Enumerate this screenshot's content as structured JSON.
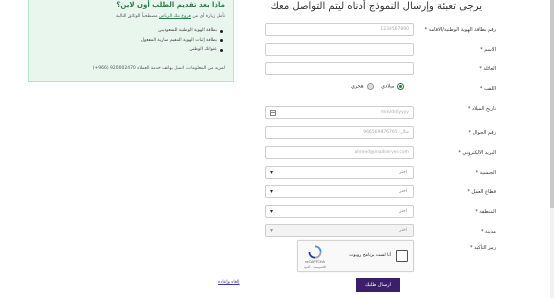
{
  "info_box": {
    "title": "ماذا بعد تقديم الطلب أون لاين؟",
    "intro_prefix": "نأمل زيارة أي من",
    "intro_link": "فروع بنك الرياض",
    "intro_suffix": "مصطحباً الوثائق التالية",
    "documents": [
      "بطاقة الهوية الوطنية للسعوديين",
      "بطاقة إثبات الهوية المقيم سارية المفعول",
      "عنوانك الوطني"
    ],
    "contact": "لمزيد من المعلومات، اتصل بهاتف خدمة العملاء 920002470 (966+)"
  },
  "form": {
    "heading": "يرجى تعبئة وإرسال النموذج أدناه ليتم التواصل معك",
    "labels": {
      "id_number": "رقم بطاقة الهوية الوطنية/الاقامة *",
      "name": "الاسم *",
      "family": "العائلة *",
      "title": "اللقب *",
      "birth_date": "تاريخ الميلاد *",
      "mobile": "رقم الجوال *",
      "email": "البريد الالكتروني *",
      "nationality": "الجنسية *",
      "work_sector": "قطاع العمل *",
      "region": "المنطقة *",
      "city": "مدينة *",
      "captcha": "رمز التأكيد *"
    },
    "fields": {
      "id_placeholder": "1234567890",
      "name_value": "",
      "family_value": "",
      "birth_placeholder": "mm/dd/yyyy",
      "mobile_placeholder": "مثال: 966569876765",
      "email_placeholder": "ahmed@mailserver.com",
      "nationality_selected": "اختر",
      "work_sector_selected": "اختر",
      "region_selected": "اختر",
      "city_selected": "اختر"
    },
    "title_options": {
      "option_1": "ميلادي",
      "option_2": "هجري",
      "selected": "ميلادي"
    },
    "captcha": {
      "checkbox_label": "أنا لست برنامج روبوت",
      "brand": "reCAPTCHA",
      "terms": "الخصوصية - البنود"
    },
    "submit_label": "ارسال طلبك",
    "reset_label": "إلغاء وإعادة"
  },
  "colors": {
    "brand_purple": "#3b1f6b",
    "accent_green": "#2d7c47",
    "info_bg": "#e9f6ee"
  },
  "icons": {
    "calendar": "calendar-icon",
    "chevron": "chevron-down-icon",
    "recaptcha": "recaptcha-logo-icon"
  }
}
